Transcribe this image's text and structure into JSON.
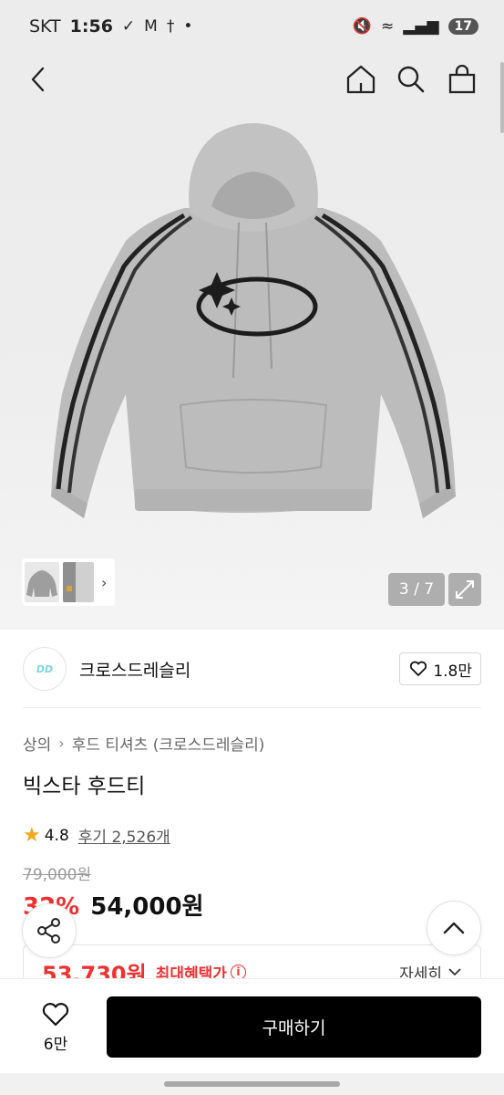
{
  "status_bar": {
    "carrier": "SKT",
    "time": "1:56",
    "battery": "17"
  },
  "gallery": {
    "counter": "3 / 7"
  },
  "brand": {
    "name": "크로스드레슬리",
    "logo_text": "DD",
    "likes": "1.8만"
  },
  "breadcrumb": [
    "상의",
    "후드 티셔츠 (크로스드레슬리)"
  ],
  "product": {
    "title": "빅스타 후드티",
    "rating": "4.8",
    "reviews": "후기 2,526개",
    "original_price": "79,000원",
    "discount": "32%",
    "sale_price": "54,000원"
  },
  "benefit": {
    "price": "53,730원",
    "label": "최대혜택가",
    "detail": "자세히"
  },
  "bottom_bar": {
    "wish_count": "6만",
    "buy_label": "구매하기"
  },
  "colors": {
    "accent_red": "#ee3131",
    "star": "#f2a81d",
    "buy_button": "#000000"
  },
  "icons": [
    "back-arrow-icon",
    "home-icon",
    "search-icon",
    "shopping-bag-icon",
    "expand-icon",
    "heart-icon",
    "star-icon",
    "info-icon",
    "chevron-down-icon",
    "share-icon",
    "chevron-up-icon"
  ]
}
